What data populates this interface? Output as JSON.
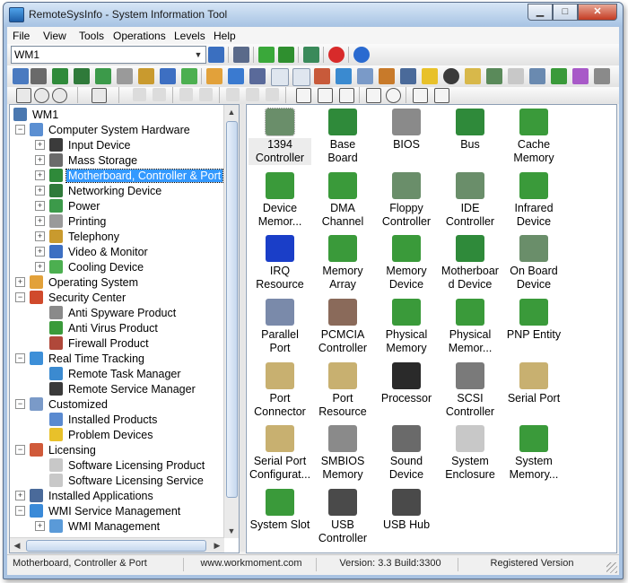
{
  "window": {
    "title": "RemoteSysInfo - System Information Tool"
  },
  "menu": [
    "File",
    "View",
    "Tools",
    "Operations",
    "Levels",
    "Help"
  ],
  "toolbar": {
    "computer_combo_value": "WM1"
  },
  "tree": [
    {
      "label": "WM1",
      "icon": "network-computer-icon",
      "level": 0,
      "expander": "",
      "color": "#4a78b0"
    },
    {
      "label": "Computer System Hardware",
      "icon": "computer-icon",
      "level": 1,
      "expander": "−",
      "color": "#5b8fd2"
    },
    {
      "label": "Input Device",
      "icon": "keyboard-icon",
      "level": 2,
      "expander": "+",
      "color": "#3b3b3b"
    },
    {
      "label": "Mass Storage",
      "icon": "hard-disk-icon",
      "level": 2,
      "expander": "+",
      "color": "#6b6b6b"
    },
    {
      "label": "Motherboard, Controller & Port",
      "icon": "motherboard-icon",
      "level": 2,
      "expander": "+",
      "color": "#2f8a3a",
      "selected": true
    },
    {
      "label": "Networking Device",
      "icon": "network-card-icon",
      "level": 2,
      "expander": "+",
      "color": "#2f7a3a"
    },
    {
      "label": "Power",
      "icon": "power-icon",
      "level": 2,
      "expander": "+",
      "color": "#3c9a4a"
    },
    {
      "label": "Printing",
      "icon": "printer-icon",
      "level": 2,
      "expander": "+",
      "color": "#9a9a9a"
    },
    {
      "label": "Telephony",
      "icon": "telephone-icon",
      "level": 2,
      "expander": "+",
      "color": "#c99a2e"
    },
    {
      "label": "Video & Monitor",
      "icon": "monitor-icon",
      "level": 2,
      "expander": "+",
      "color": "#3d6fc2"
    },
    {
      "label": "Cooling Device",
      "icon": "fan-icon",
      "level": 2,
      "expander": "+",
      "color": "#4caf50"
    },
    {
      "label": "Operating System",
      "icon": "windows-logo-icon",
      "level": 1,
      "expander": "+",
      "color": "#e2a13a"
    },
    {
      "label": "Security Center",
      "icon": "shield-icon",
      "level": 1,
      "expander": "−",
      "color": "#d04a2c"
    },
    {
      "label": "Anti Spyware Product",
      "icon": "anti-spyware-icon",
      "level": 2,
      "expander": "",
      "color": "#8a8a8a"
    },
    {
      "label": "Anti Virus Product",
      "icon": "antivirus-shield-icon",
      "level": 2,
      "expander": "",
      "color": "#3a9a3a"
    },
    {
      "label": "Firewall Product",
      "icon": "firewall-icon",
      "level": 2,
      "expander": "",
      "color": "#b0483a"
    },
    {
      "label": "Real Time Tracking",
      "icon": "tracking-icon",
      "level": 1,
      "expander": "−",
      "color": "#3d8fd8"
    },
    {
      "label": "Remote Task Manager",
      "icon": "task-manager-icon",
      "level": 2,
      "expander": "",
      "color": "#3b8ad0"
    },
    {
      "label": "Remote Service Manager",
      "icon": "gear-icon",
      "level": 2,
      "expander": "",
      "color": "#3a3a3a"
    },
    {
      "label": "Customized",
      "icon": "customized-icon",
      "level": 1,
      "expander": "−",
      "color": "#7a9ac8"
    },
    {
      "label": "Installed Products",
      "icon": "installer-icon",
      "level": 2,
      "expander": "",
      "color": "#5a8ad0"
    },
    {
      "label": "Problem Devices",
      "icon": "warning-icon",
      "level": 2,
      "expander": "",
      "color": "#e8c12a"
    },
    {
      "label": "Licensing",
      "icon": "license-icon",
      "level": 1,
      "expander": "−",
      "color": "#d05a3a"
    },
    {
      "label": "Software Licensing Product",
      "icon": "license-document-icon",
      "level": 2,
      "expander": "",
      "color": "#c8c8c8"
    },
    {
      "label": "Software Licensing Service",
      "icon": "license-document-icon",
      "level": 2,
      "expander": "",
      "color": "#c8c8c8"
    },
    {
      "label": "Installed Applications",
      "icon": "applications-icon",
      "level": 1,
      "expander": "+",
      "color": "#4a6a9a"
    },
    {
      "label": "WMI Service Management",
      "icon": "globe-icon",
      "level": 1,
      "expander": "−",
      "color": "#3a8ad8"
    },
    {
      "label": "WMI Management",
      "icon": "globe-gear-icon",
      "level": 2,
      "expander": "+",
      "color": "#5a9ad8"
    }
  ],
  "items": [
    {
      "label": "1394\nController",
      "icon": "controller-icon",
      "color": "#6a8e6a",
      "selected": true
    },
    {
      "label": "Base\nBoard",
      "icon": "motherboard-icon",
      "color": "#2f8a3a"
    },
    {
      "label": "BIOS",
      "icon": "chip-icon",
      "color": "#8a8a8a"
    },
    {
      "label": "Bus",
      "icon": "motherboard-icon",
      "color": "#2f8a3a"
    },
    {
      "label": "Cache\nMemory",
      "icon": "memory-module-icon",
      "color": "#3a9a3a"
    },
    {
      "label": "Device\nMemor...",
      "icon": "memory-module-icon",
      "color": "#3a9a3a"
    },
    {
      "label": "DMA\nChannel",
      "icon": "memory-module-icon",
      "color": "#3a9a3a"
    },
    {
      "label": "Floppy\nController",
      "icon": "controller-icon",
      "color": "#6a8e6a"
    },
    {
      "label": "IDE\nController",
      "icon": "controller-icon",
      "color": "#6a8e6a"
    },
    {
      "label": "Infrared\nDevice",
      "icon": "infrared-icon",
      "color": "#3a9a3a"
    },
    {
      "label": "IRQ\nResource",
      "icon": "cpu-icon",
      "color": "#1a3ec8"
    },
    {
      "label": "Memory\nArray",
      "icon": "memory-module-icon",
      "color": "#3a9a3a"
    },
    {
      "label": "Memory\nDevice",
      "icon": "memory-module-icon",
      "color": "#3a9a3a"
    },
    {
      "label": "Motherboar\nd Device",
      "icon": "motherboard-icon",
      "color": "#2f8a3a"
    },
    {
      "label": "On Board\nDevice",
      "icon": "controller-icon",
      "color": "#6a8e6a"
    },
    {
      "label": "Parallel\nPort",
      "icon": "parallel-port-icon",
      "color": "#7a8aaa"
    },
    {
      "label": "PCMCIA\nController",
      "icon": "pcmcia-card-icon",
      "color": "#8a6a5a"
    },
    {
      "label": "Physical\nMemory",
      "icon": "memory-module-icon",
      "color": "#3a9a3a"
    },
    {
      "label": "Physical\nMemor...",
      "icon": "memory-module-icon",
      "color": "#3a9a3a"
    },
    {
      "label": "PNP Entity",
      "icon": "pnp-plug-icon",
      "color": "#3a9a3a"
    },
    {
      "label": "Port\nConnector",
      "icon": "serial-cable-icon",
      "color": "#c8b070"
    },
    {
      "label": "Port\nResource",
      "icon": "serial-cable-icon",
      "color": "#c8b070"
    },
    {
      "label": "Processor",
      "icon": "processor-icon",
      "color": "#2a2a2a"
    },
    {
      "label": "SCSI\nController",
      "icon": "scsi-icon",
      "color": "#7a7a7a"
    },
    {
      "label": "Serial Port",
      "icon": "serial-cable-icon",
      "color": "#c8b070"
    },
    {
      "label": "Serial Port\nConfigurat...",
      "icon": "serial-cable-icon",
      "color": "#c8b070"
    },
    {
      "label": "SMBIOS\nMemory",
      "icon": "chip-icon",
      "color": "#8a8a8a"
    },
    {
      "label": "Sound\nDevice",
      "icon": "speaker-icon",
      "color": "#6a6a6a"
    },
    {
      "label": "System\nEnclosure",
      "icon": "tower-case-icon",
      "color": "#c8c8c8"
    },
    {
      "label": "System\nMemory...",
      "icon": "memory-module-icon",
      "color": "#3a9a3a"
    },
    {
      "label": "System Slot",
      "icon": "system-slot-icon",
      "color": "#3a9a3a"
    },
    {
      "label": "USB\nController",
      "icon": "usb-icon",
      "color": "#4a4a4a"
    },
    {
      "label": "USB Hub",
      "icon": "usb-icon",
      "color": "#4a4a4a"
    }
  ],
  "status": {
    "selection": "Motherboard, Controller & Port",
    "website": "www.workmoment.com",
    "version": "Version: 3.3 Build:3300",
    "registration": "Registered Version"
  }
}
